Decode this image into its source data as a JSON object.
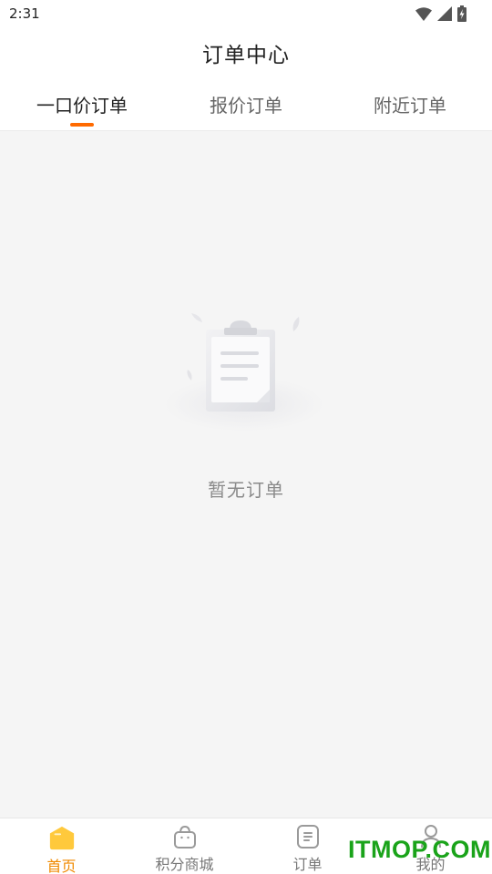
{
  "status_bar": {
    "time": "2:31",
    "icons": [
      "wifi-icon",
      "cell-signal-icon",
      "battery-charging-icon"
    ]
  },
  "header": {
    "title": "订单中心"
  },
  "tabs": [
    {
      "label": "一口价订单",
      "active": true
    },
    {
      "label": "报价订单",
      "active": false
    },
    {
      "label": "附近订单",
      "active": false
    }
  ],
  "empty_state": {
    "illustration": "clipboard-empty-icon",
    "message": "暂无订单"
  },
  "bottom_nav": [
    {
      "label": "首页",
      "icon": "home-icon",
      "active": true
    },
    {
      "label": "积分商城",
      "icon": "shopping-bag-icon",
      "active": false
    },
    {
      "label": "订单",
      "icon": "order-list-icon",
      "active": false
    },
    {
      "label": "我的",
      "icon": "user-icon",
      "active": false
    }
  ],
  "watermark": {
    "text": "ITMOP.COM"
  },
  "colors": {
    "accent": "#ff6a00",
    "active_nav": "#f08a00",
    "home_icon": "#ffc93c",
    "background": "#f5f5f5",
    "watermark": "#1aa31a"
  }
}
